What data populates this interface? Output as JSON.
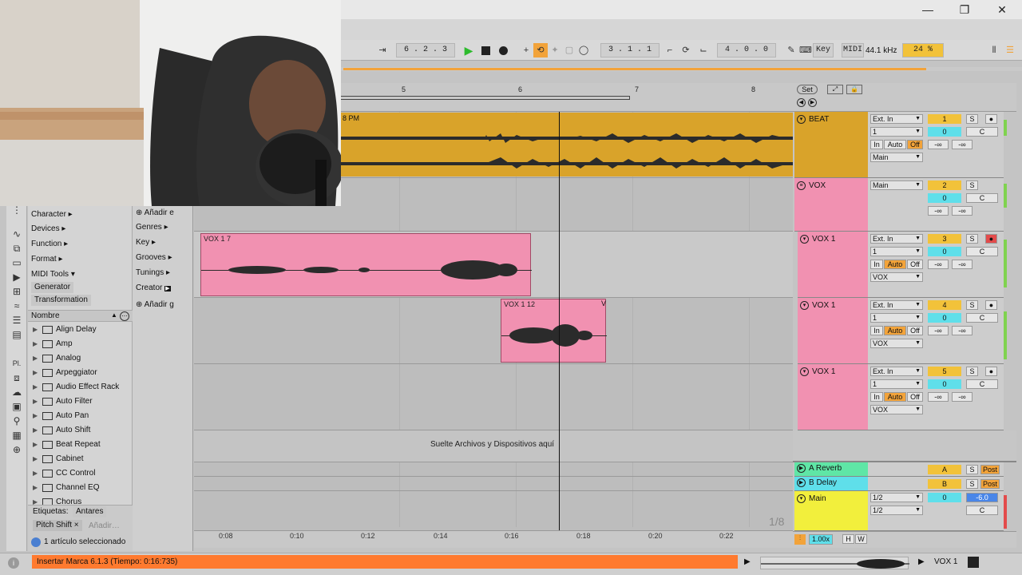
{
  "window": {
    "min": "—",
    "max": "❐",
    "close": "✕"
  },
  "transport": {
    "arrangement_pos": "6 . 2 . 3",
    "loop_start": "3 . 1 . 1",
    "loop_len": "4 . 0 . 0",
    "key_label": "Key",
    "midi_label": "MIDI",
    "sample_rate": "44.1 kHz",
    "cpu": "24 %"
  },
  "ruler": {
    "bars": [
      "5",
      "6",
      "7",
      "8"
    ],
    "set_btn": "Set"
  },
  "browser": {
    "categories": [
      "Character ▸",
      "Devices ▸",
      "Function ▸",
      "Format ▸",
      "MIDI Tools ▾"
    ],
    "midi_tools_chips": [
      "Generator",
      "Transformation"
    ],
    "col2": [
      "Añadir e",
      "Genres ▸",
      "Key ▸",
      "Grooves ▸",
      "Tunings ▸",
      "Creator",
      "Añadir g"
    ],
    "header": "Nombre",
    "items": [
      "Align Delay",
      "Amp",
      "Analog",
      "Arpeggiator",
      "Audio Effect Rack",
      "Auto Filter",
      "Auto Pan",
      "Auto Shift",
      "Beat Repeat",
      "Cabinet",
      "CC Control",
      "Channel EQ",
      "Chorus"
    ],
    "tags_label": "Etiquetas:",
    "tag_antares": "Antares",
    "tag_pitchshift": "Pitch Shift",
    "tag_add": "Añadir…",
    "selection": "1 artículo seleccionado"
  },
  "clips": {
    "beat": "8 PM",
    "vox17": "VOX 1 7",
    "vox112": "VOX 1 12",
    "vox112b": "V"
  },
  "drop_text": "Suelte Archivos y Dispositivos aquí",
  "tracks": [
    {
      "name": "BEAT",
      "input": "Ext. In",
      "ch": "1",
      "num": "1",
      "vol": "0",
      "pan": "C",
      "monitor": [
        "In",
        "Auto",
        "Off"
      ],
      "out": "Main",
      "send1": "-∞",
      "send2": "-∞"
    },
    {
      "name": "VOX",
      "input": "Main",
      "num": "2",
      "vol": "0",
      "pan": "C",
      "send1": "-∞",
      "send2": "-∞"
    },
    {
      "name": "VOX 1",
      "input": "Ext. In",
      "ch": "1",
      "num": "3",
      "vol": "0",
      "pan": "C",
      "monitor": [
        "In",
        "Auto",
        "Off"
      ],
      "out": "VOX",
      "send1": "-∞",
      "send2": "-∞"
    },
    {
      "name": "VOX 1",
      "input": "Ext. In",
      "ch": "1",
      "num": "4",
      "vol": "0",
      "pan": "C",
      "monitor": [
        "In",
        "Auto",
        "Off"
      ],
      "out": "VOX",
      "send1": "-∞",
      "send2": "-∞"
    },
    {
      "name": "VOX 1",
      "input": "Ext. In",
      "ch": "1",
      "num": "5",
      "vol": "0",
      "pan": "C",
      "monitor": [
        "In",
        "Auto",
        "Off"
      ],
      "out": "VOX",
      "send1": "-∞",
      "send2": "-∞"
    }
  ],
  "returns": [
    {
      "name": "A Reverb",
      "letter": "A",
      "post": "Post"
    },
    {
      "name": "B Delay",
      "letter": "B",
      "post": "Post"
    }
  ],
  "main": {
    "name": "Main",
    "out1": "1/2",
    "out2": "1/2",
    "vol": "0",
    "db": "-6.0",
    "pan": "C"
  },
  "timeline": [
    "0:08",
    "0:10",
    "0:12",
    "0:14",
    "0:16",
    "0:18",
    "0:20",
    "0:22"
  ],
  "grid_fraction": "1/8",
  "zoom": "1.00x",
  "hw": [
    "H",
    "W"
  ],
  "status": "Insertar Marca 6.1.3 (Tiempo: 0:16:735)",
  "footer_track": "VOX 1",
  "colors": {
    "beat": "#d9a32a",
    "vox": "#f191b1",
    "reverb": "#5fe6a6",
    "delay": "#5fdfea",
    "main": "#f2ef3c",
    "accent": "#ff7a2f"
  }
}
